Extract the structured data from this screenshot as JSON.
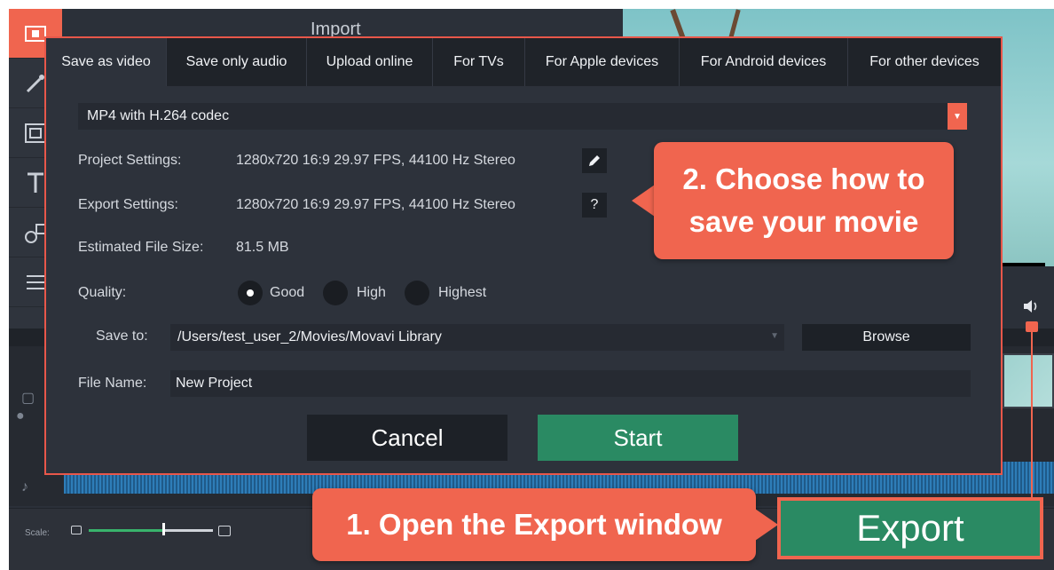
{
  "app": {
    "section_title": "Import",
    "scale_label": "Scale:"
  },
  "dialog": {
    "tabs": [
      {
        "label": "Save as video",
        "active": true
      },
      {
        "label": "Save only audio",
        "active": false
      },
      {
        "label": "Upload online",
        "active": false
      },
      {
        "label": "For TVs",
        "active": false
      },
      {
        "label": "For Apple devices",
        "active": false
      },
      {
        "label": "For Android devices",
        "active": false
      },
      {
        "label": "For other devices",
        "active": false
      }
    ],
    "format": "MP4 with H.264 codec",
    "project_settings_label": "Project Settings:",
    "project_settings_value": "1280x720 16:9 29.97 FPS, 44100 Hz Stereo",
    "export_settings_label": "Export Settings:",
    "export_settings_value": "1280x720 16:9 29.97 FPS, 44100 Hz Stereo",
    "help_button": "?",
    "estimated_size_label": "Estimated File Size:",
    "estimated_size_value": "81.5 MB",
    "quality_label": "Quality:",
    "quality_options": [
      {
        "label": "Good",
        "selected": true
      },
      {
        "label": "High",
        "selected": false
      },
      {
        "label": "Highest",
        "selected": false
      }
    ],
    "save_to_label": "Save to:",
    "save_to_value": "/Users/test_user_2/Movies/Movavi Library",
    "browse_button": "Browse",
    "file_name_label": "File Name:",
    "file_name_value": "New Project",
    "cancel_button": "Cancel",
    "start_button": "Start"
  },
  "callouts": {
    "step2_line1": "2. Choose how to",
    "step2_line2": "save your movie",
    "step1": "1. Open the Export window"
  },
  "export_button": "Export",
  "colors": {
    "accent": "#f0654f",
    "start_green": "#2a8a63",
    "dialog_bg": "#2d323b"
  }
}
